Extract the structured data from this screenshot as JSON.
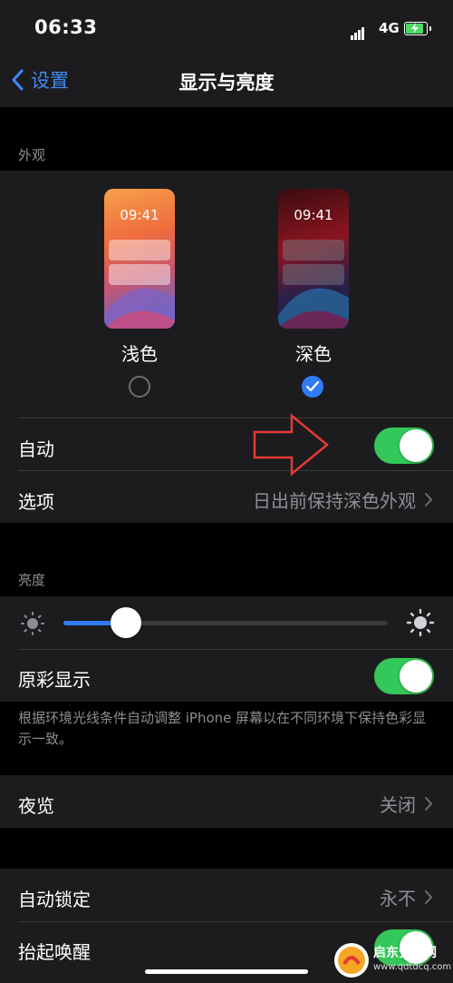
{
  "status": {
    "time": "06:33",
    "network": "4G"
  },
  "nav": {
    "back_label": "设置",
    "title": "显示与亮度"
  },
  "appearance": {
    "header": "外观",
    "preview_time": "09:41",
    "light_label": "浅色",
    "dark_label": "深色",
    "selected": "dark",
    "auto_label": "自动",
    "auto_on": true,
    "options_label": "选项",
    "options_value": "日出前保持深色外观"
  },
  "brightness": {
    "header": "亮度",
    "level": 0.16,
    "true_tone_label": "原彩显示",
    "true_tone_on": true,
    "note": "根据环境光线条件自动调整 iPhone 屏幕以在不同环境下保持色彩显示一致。"
  },
  "night_shift": {
    "label": "夜览",
    "value": "关闭"
  },
  "lock": {
    "auto_lock_label": "自动锁定",
    "auto_lock_value": "永不",
    "raise_to_wake_label": "抬起唤醒"
  },
  "watermark": {
    "title": "启东安卓网",
    "url": "www.qdtdcq.com"
  },
  "colors": {
    "accent": "#2f7cf6",
    "toggle_on": "#34c759",
    "annotation_arrow": "#e53935"
  }
}
